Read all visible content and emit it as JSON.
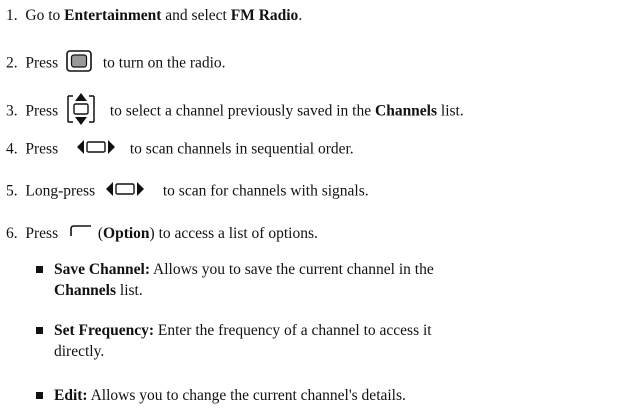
{
  "steps": [
    {
      "num": "1.",
      "parts": [
        "Go to ",
        "Entertainment",
        " and select ",
        "FM Radio",
        "."
      ]
    },
    {
      "num": "2.",
      "pre": "Press",
      "post": "to turn on the radio.",
      "icon": "square-key-icon"
    },
    {
      "num": "3.",
      "pre": "Press",
      "post": "to select a channel previously saved in the ",
      "bold": "Channels",
      "tail": " list.",
      "icon": "up-down-key-icon"
    },
    {
      "num": "4.",
      "pre": "Press",
      "post": "to scan channels in sequential order.",
      "icon": "left-right-key-icon"
    },
    {
      "num": "5.",
      "pre": "Long-press",
      "post": "to scan for channels with signals.",
      "icon": "left-right-key-icon"
    },
    {
      "num": "6.",
      "pre": "Press",
      "post": " (",
      "bold": "Option",
      "tail": ") to access a list of options.",
      "icon": "option-softkey-icon"
    }
  ],
  "options": [
    {
      "term": "Save Channel:",
      "text1": " Allows you to save the current channel in the",
      "bold2": "Channels",
      "text2": " list."
    },
    {
      "term": "Set Frequency:",
      "text1": " Enter the frequency of a channel to access it",
      "text2": "directly."
    },
    {
      "term": "Edit:",
      "text1": " Allows you to change the current channel's details."
    }
  ]
}
